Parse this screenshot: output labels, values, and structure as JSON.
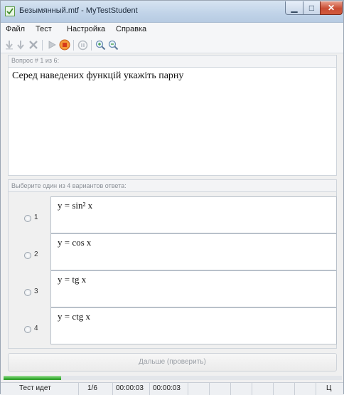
{
  "window": {
    "title": "Безымянный.mtf - MyTestStudent",
    "min_glyph": "▁",
    "max_glyph": "□",
    "close_glyph": "✕"
  },
  "menu": {
    "items": [
      {
        "label": "Файл"
      },
      {
        "label": "Тест"
      },
      {
        "label": "Настройка"
      },
      {
        "label": "Справка"
      }
    ]
  },
  "toolbar": {
    "icons": [
      "arrow-down-icon",
      "arrow-down-icon",
      "close-icon",
      "play-icon",
      "stop-icon",
      "pause-icon",
      "zoom-in-icon",
      "zoom-out-icon"
    ]
  },
  "question": {
    "header": "Вопрос # 1 из 6:",
    "text": "Серед наведених функцій укажіть парну"
  },
  "answers": {
    "header": "Выберите один из 4 вариантов ответа:",
    "options": [
      {
        "num": "1",
        "text": "y = sin² x"
      },
      {
        "num": "2",
        "text": "y = cos x"
      },
      {
        "num": "3",
        "text": "y = tg x"
      },
      {
        "num": "4",
        "text": "y = ctg x"
      }
    ]
  },
  "next_button": {
    "label": "Дальше (проверить)"
  },
  "progress": {
    "value": 0.17
  },
  "status": {
    "state": "Тест идет",
    "position": "1/6",
    "elapsed": "00:00:03",
    "elapsed2": "00:00:03",
    "indicator": "Ц"
  },
  "colors": {
    "accent_green": "#3fb13a",
    "stop_orange": "#e8731e",
    "titlebar": "#c0d3e8"
  }
}
